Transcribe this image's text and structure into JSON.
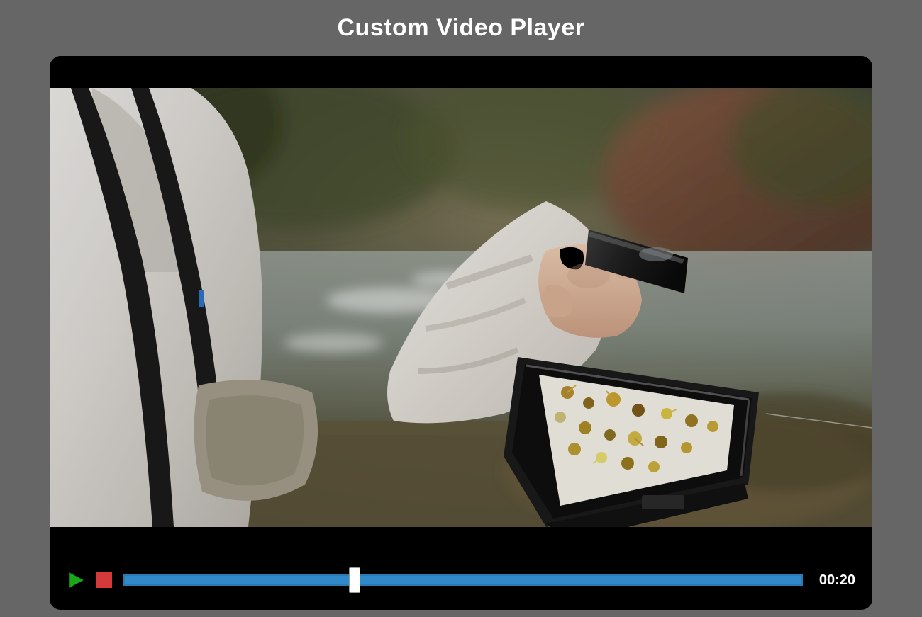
{
  "header": {
    "title": "Custom Video Player"
  },
  "player": {
    "timestamp": "00:20",
    "progress_percent": 34,
    "icons": {
      "play": "play-icon",
      "stop": "stop-icon"
    },
    "colors": {
      "play_fill": "#18a818",
      "stop_fill": "#d43a3a",
      "progress_track": "#3089c8",
      "progress_border": "#2b7ab4",
      "thumb": "#ffffff"
    }
  }
}
